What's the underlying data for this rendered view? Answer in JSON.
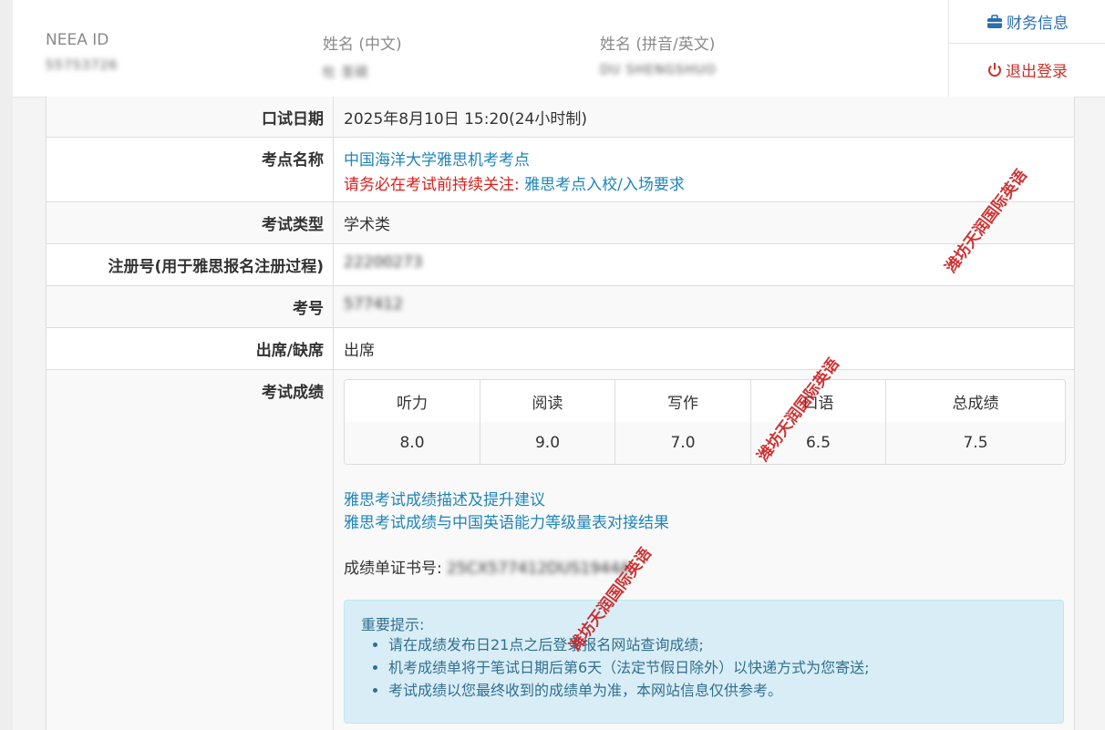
{
  "header": {
    "fields": [
      {
        "label": "NEEA ID",
        "value": "55753726"
      },
      {
        "label": "姓名 (中文)",
        "value": "杜 圣硕"
      },
      {
        "label": "姓名 (拼音/英文)",
        "value": "DU SHENGSHUO"
      }
    ],
    "menu": {
      "finance_label": "财务信息",
      "logout_label": "退出登录"
    }
  },
  "details": {
    "oral_date": {
      "label": "口试日期",
      "value": "2025年8月10日 15:20(24小时制)"
    },
    "venue": {
      "label": "考点名称",
      "name_link": "中国海洋大学雅思机考考点",
      "notice_prefix": "请务必在考试前持续关注:",
      "notice_link": "雅思考点入校/入场要求"
    },
    "exam_type": {
      "label": "考试类型",
      "value": "学术类"
    },
    "registration_no": {
      "label": "注册号(用于雅思报名注册过程)",
      "value": "22200273"
    },
    "candidate_no": {
      "label": "考号",
      "value": "577412"
    },
    "attendance": {
      "label": "出席/缺席",
      "value": "出席"
    },
    "scores_label": "考试成绩"
  },
  "scores": {
    "headers": [
      "听力",
      "阅读",
      "写作",
      "口语",
      "总成绩"
    ],
    "values": [
      "8.0",
      "9.0",
      "7.0",
      "6.5",
      "7.5"
    ]
  },
  "links": {
    "score_description": "雅思考试成绩描述及提升建议",
    "cse_alignment": "雅思考试成绩与中国英语能力等级量表对接结果"
  },
  "trf": {
    "label": "成绩单证书号:",
    "value": "25CX577412DUS1944A"
  },
  "notice": {
    "title": "重要提示:",
    "items": [
      "请在成绩发布日21点之后登录报名网站查询成绩;",
      "机考成绩单将于笔试日期后第6天（法定节假日除外）以快递方式为您寄送;",
      "考试成绩以您最终收到的成绩单为准，本网站信息仅供参考。"
    ]
  },
  "watermark": "潍坊天润国际英语",
  "colors": {
    "link": "#1f85b8",
    "alert_red": "#d9201c",
    "notice_bg": "#d9edf7",
    "watermark": "#c81d1d"
  },
  "icons": [
    "briefcase-icon",
    "power-icon"
  ]
}
